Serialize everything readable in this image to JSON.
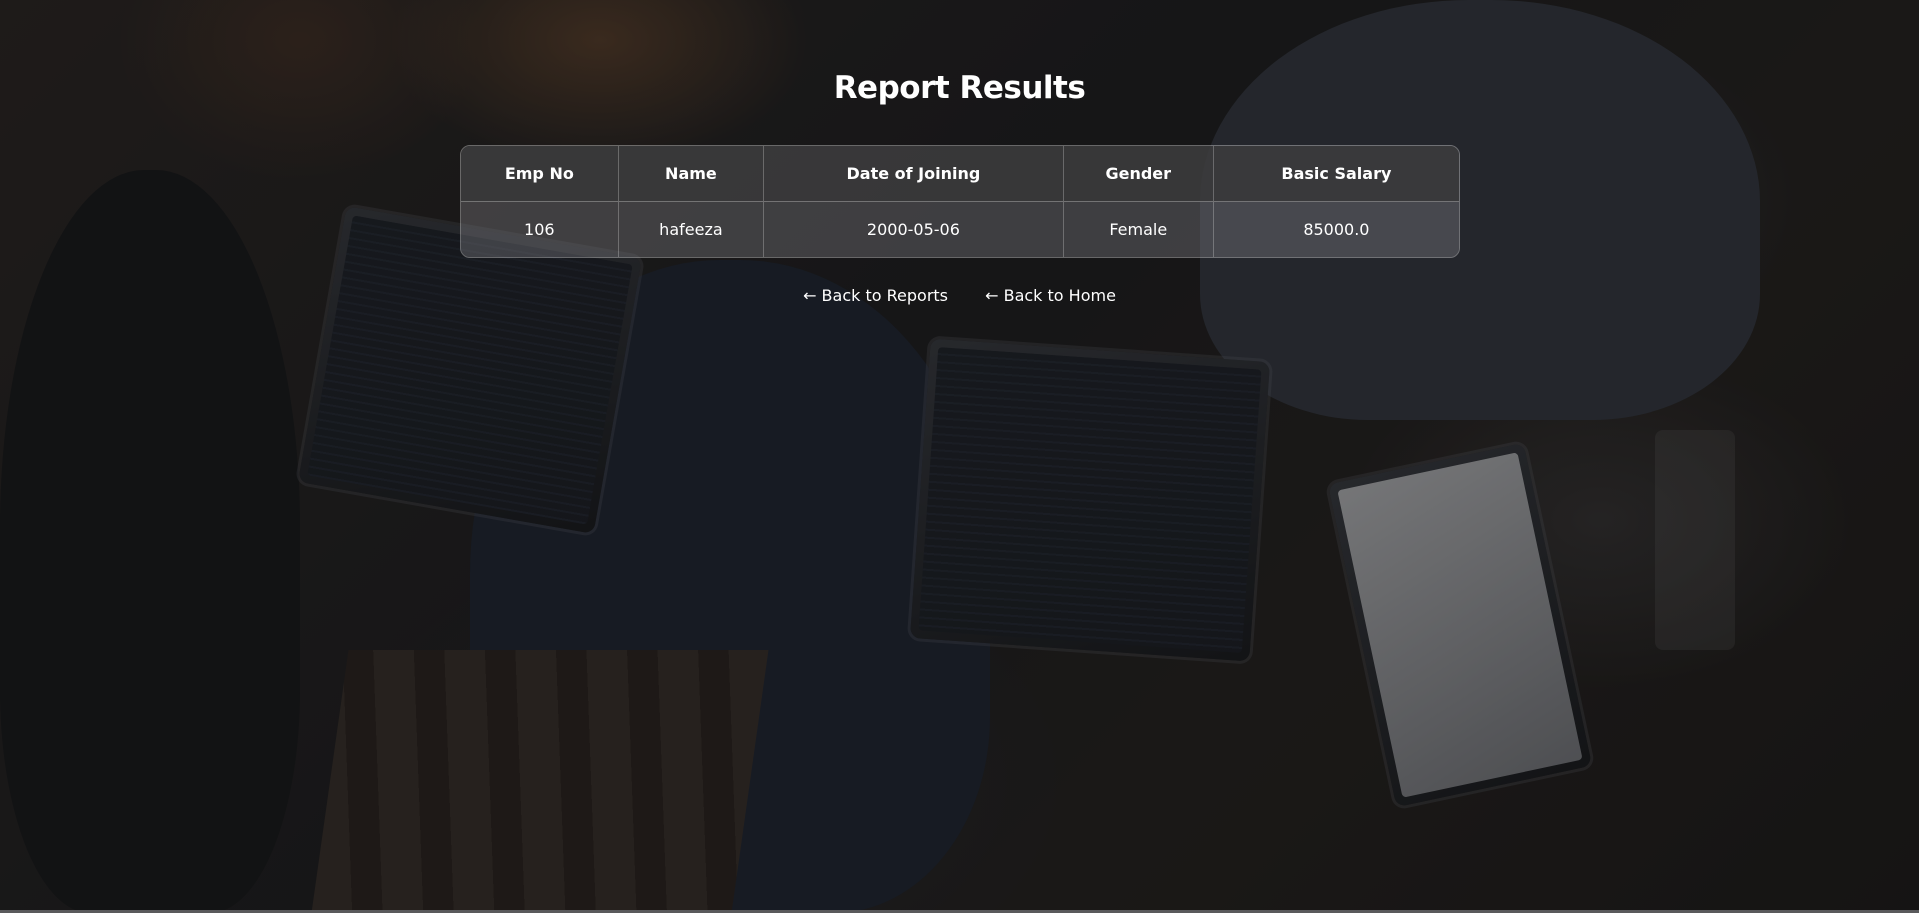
{
  "page": {
    "title": "Report Results"
  },
  "table": {
    "headers": [
      "Emp No",
      "Name",
      "Date of Joining",
      "Gender",
      "Basic Salary"
    ],
    "rows": [
      [
        "106",
        "hafeeza",
        "2000-05-06",
        "Female",
        "85000.0"
      ]
    ]
  },
  "links": {
    "back_to_reports": "← Back to Reports",
    "back_to_home": "← Back to Home"
  }
}
